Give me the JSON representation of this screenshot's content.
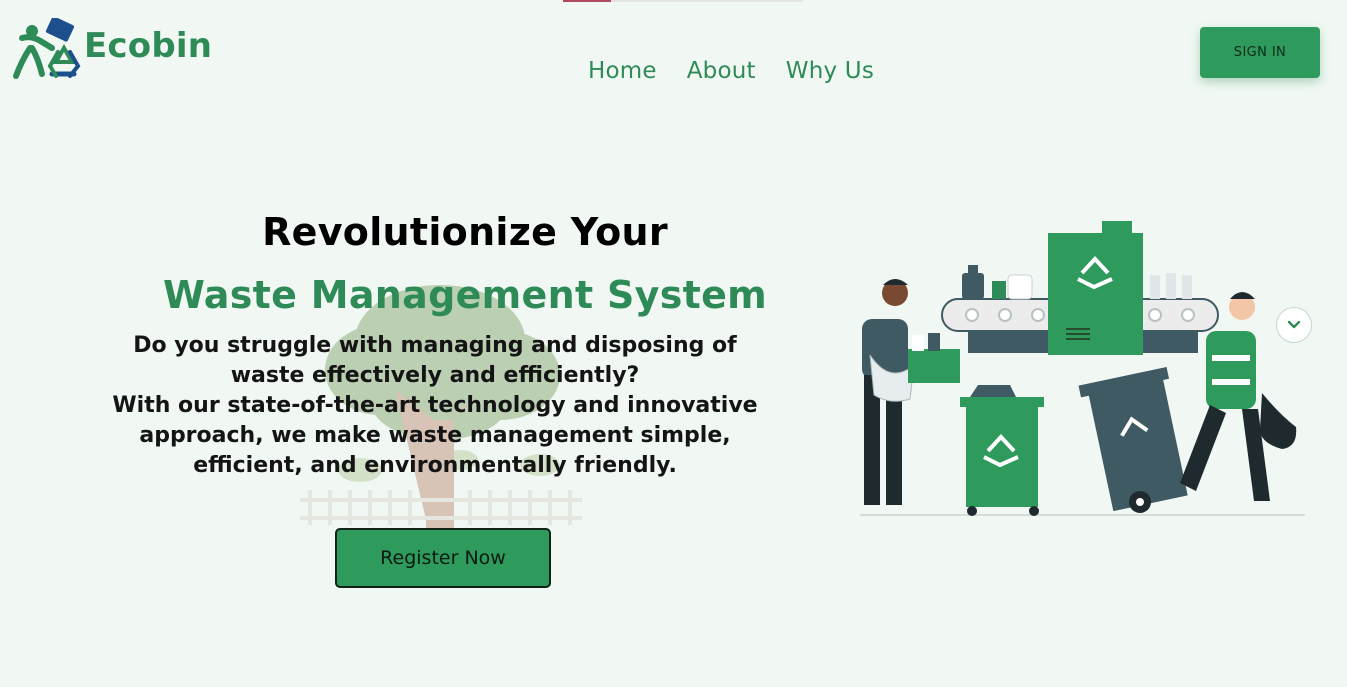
{
  "brand": {
    "name": "Ecobin"
  },
  "nav": {
    "items": [
      "Home",
      "About",
      "Why Us"
    ]
  },
  "header": {
    "signin_label": "SIGN IN"
  },
  "hero": {
    "title": "Revolutionize Your",
    "subtitle": "Waste Management System",
    "desc_lines": [
      "Do you struggle with managing and disposing of",
      "waste effectively and efficiently?",
      "With our state-of-the-art technology and innovative",
      "approach, we make waste management simple,",
      "efficient, and environmentally friendly."
    ],
    "cta_label": "Register Now"
  },
  "icons": {
    "logo": "recycle-person-icon",
    "scroll": "chevron-down-icon"
  },
  "colors": {
    "brand_green": "#2e8b57",
    "button_green": "#2e9a5c",
    "background": "#f1f8f3",
    "dark_slate": "#3f5a63"
  }
}
